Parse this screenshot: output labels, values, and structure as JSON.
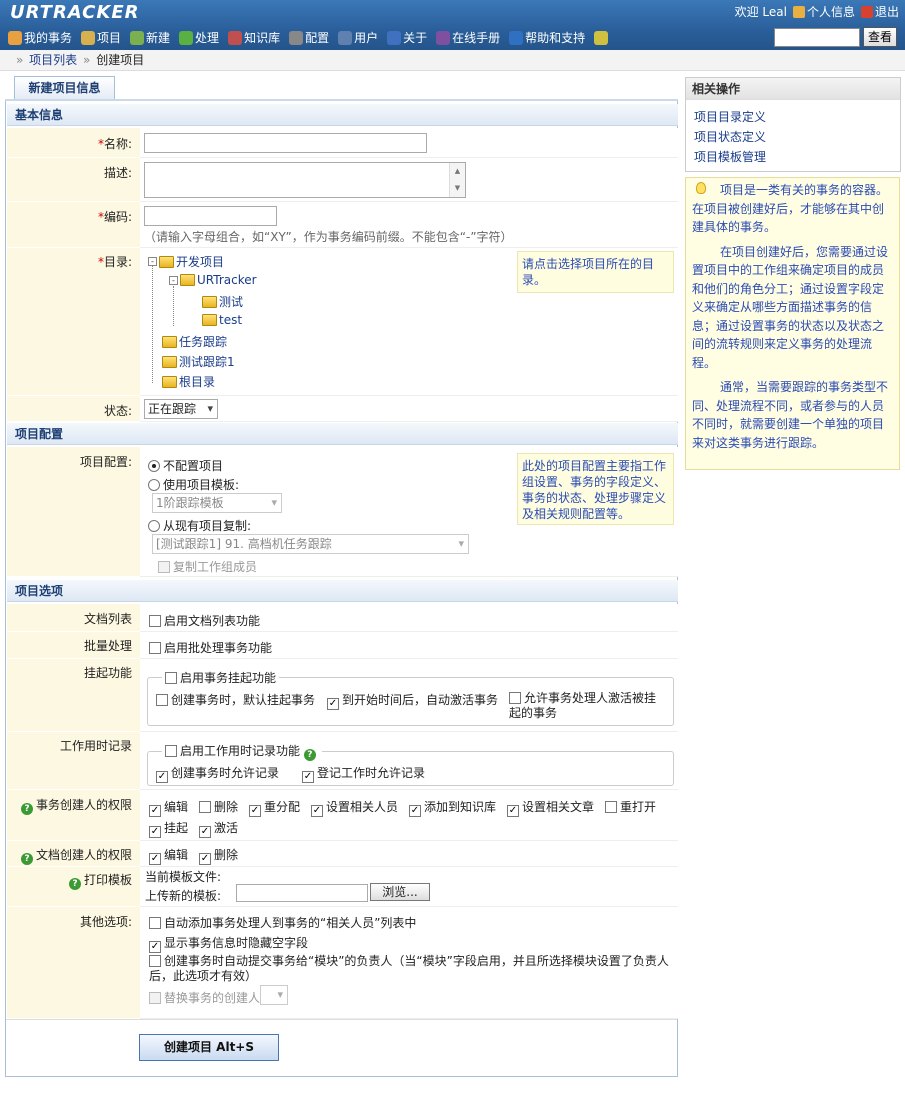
{
  "app": {
    "logo": "URTRACKER"
  },
  "userbar": {
    "welcome": "欢迎 Leal",
    "profile": "个人信息",
    "logout": "退出"
  },
  "nav": [
    {
      "label": "我的事务",
      "icon": "home-icon",
      "color": "#e8a040"
    },
    {
      "label": "项目",
      "icon": "database-icon",
      "color": "#d8b050"
    },
    {
      "label": "新建",
      "icon": "new-icon",
      "color": "#7ab050"
    },
    {
      "label": "处理",
      "icon": "check-icon",
      "color": "#5ab040"
    },
    {
      "label": "知识库",
      "icon": "books-icon",
      "color": "#c05050"
    },
    {
      "label": "配置",
      "icon": "gear-icon",
      "color": "#888888"
    },
    {
      "label": "用户",
      "icon": "users-icon",
      "color": "#6080b0"
    },
    {
      "label": "关于",
      "icon": "info-icon",
      "color": "#4070c0"
    },
    {
      "label": "在线手册",
      "icon": "book-icon",
      "color": "#8050a0"
    },
    {
      "label": "帮助和支持",
      "icon": "help-icon",
      "color": "#3070c0"
    },
    {
      "label": "",
      "icon": "star-icon",
      "color": "#d0c040"
    }
  ],
  "search": {
    "button": "查看",
    "value": ""
  },
  "breadcrumb": {
    "parent": "项目列表",
    "current": "创建项目",
    "sep": "»"
  },
  "tab": {
    "label": "新建项目信息"
  },
  "sections": {
    "basic": "基本信息",
    "config": "项目配置",
    "options": "项目选项"
  },
  "basic": {
    "name_label": "名称:",
    "desc_label": "描述:",
    "code_label": "编码:",
    "dir_label": "目录:",
    "status_label": "状态:",
    "required_mark": "*",
    "code_hint": "（请输入字母组合，如“XY”，作为事务编码前缀。不能包含“-”字符）",
    "dir_note": "请点击选择项目所在的目录。",
    "tree": [
      "开发项目",
      "URTracker",
      "测试",
      "test",
      "任务跟踪",
      "测试跟踪1",
      "根目录"
    ],
    "tree_pm": [
      "-",
      "-"
    ],
    "status_value": "正在跟踪"
  },
  "config": {
    "label": "项目配置:",
    "radio_none": "不配置项目",
    "radio_template": "使用项目模板:",
    "template_select": "1阶跟踪模板",
    "radio_copy": "从现有项目复制:",
    "copy_select": "[测试跟踪1] 91. 高档机任务跟踪",
    "copy_members": "复制工作组成员",
    "note": "此处的项目配置主要指工作组设置、事务的字段定义、事务的状态、处理步骤定义及相关规则配置等。"
  },
  "options": {
    "doclist_label": "文档列表",
    "doclist_opt": "启用文档列表功能",
    "batch_label": "批量处理",
    "batch_opt": "启用批处理事务功能",
    "suspend_label": "挂起功能",
    "suspend_legend": "启用事务挂起功能",
    "suspend_opt1": "创建事务时，默认挂起事务",
    "suspend_opt2": "到开始时间后，自动激活事务",
    "suspend_opt3": "允许事务处理人激活被挂起的事务",
    "worklog_label": "工作用时记录",
    "worklog_legend": "启用工作用时记录功能",
    "worklog_opt1": "创建事务时允许记录",
    "worklog_opt2": "登记工作时允许记录",
    "creator_label": "事务创建人的权限",
    "creator_perms": [
      "编辑",
      "删除",
      "重分配",
      "设置相关人员",
      "添加到知识库",
      "设置相关文章",
      "重打开",
      "挂起",
      "激活"
    ],
    "doc_creator_label": "文档创建人的权限",
    "doc_perms": [
      "编辑",
      "删除"
    ],
    "print_label": "打印模板",
    "current_template": "当前模板文件:",
    "upload_template": "上传新的模板:",
    "browse": "浏览...",
    "other_label": "其他选项:",
    "other_opt1": "自动添加事务处理人到事务的“相关人员”列表中",
    "other_opt2": "显示事务信息时隐藏空字段",
    "other_opt3": "创建事务时自动提交事务给“模块”的负责人（当“模块”字段启用，并且所选择模块设置了负责人后，此选项才有效）",
    "other_opt4": "替换事务的创建人"
  },
  "submit": {
    "label": "创建项目  Alt+S"
  },
  "side": {
    "title": "相关操作",
    "links": [
      "项目目录定义",
      "项目状态定义",
      "项目模板管理"
    ],
    "help_p1": "项目是一类有关的事务的容器。在项目被创建好后，才能够在其中创建具体的事务。",
    "help_p2": "在项目创建好后，您需要通过设置项目中的工作组来确定项目的成员和他们的角色分工；通过设置字段定义来确定从哪些方面描述事务的信息；通过设置事务的状态以及状态之间的流转规则来定义事务的处理流程。",
    "help_p3": "通常，当需要跟踪的事务类型不同、处理流程不同，或者参与的人员不同时，就需要创建一个单独的项目来对这类事务进行跟踪。"
  }
}
